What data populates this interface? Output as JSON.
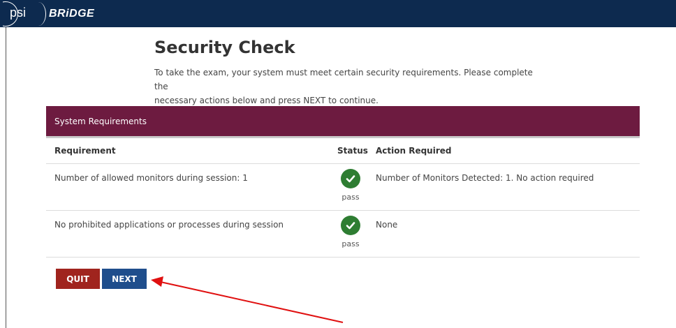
{
  "header": {
    "logo_psi": "psi",
    "logo_bridge": "BRiDGE"
  },
  "page": {
    "title": "Security Check",
    "intro_line1": "To take the exam, your system must meet certain security requirements. Please complete the",
    "intro_line2": "necessary actions below and press NEXT to continue."
  },
  "panel": {
    "title": "System Requirements"
  },
  "table": {
    "headers": {
      "requirement": "Requirement",
      "status": "Status",
      "action": "Action Required"
    },
    "rows": [
      {
        "requirement": "Number of allowed monitors during session: 1",
        "status": "pass",
        "action": "Number of Monitors Detected: 1. No action required"
      },
      {
        "requirement": "No prohibited applications or processes during session",
        "status": "pass",
        "action": "None"
      }
    ]
  },
  "buttons": {
    "quit": "QUIT",
    "next": "NEXT"
  },
  "colors": {
    "header_bg": "#0d2a4f",
    "panel_bg": "#6d1b40",
    "pass_green": "#2e7d32",
    "quit_red": "#a0241e",
    "next_blue": "#1f4e8c",
    "annotation_arrow": "#e01010"
  },
  "icons": {
    "status_pass": "check-circle-icon",
    "annotation": "arrow-icon"
  }
}
